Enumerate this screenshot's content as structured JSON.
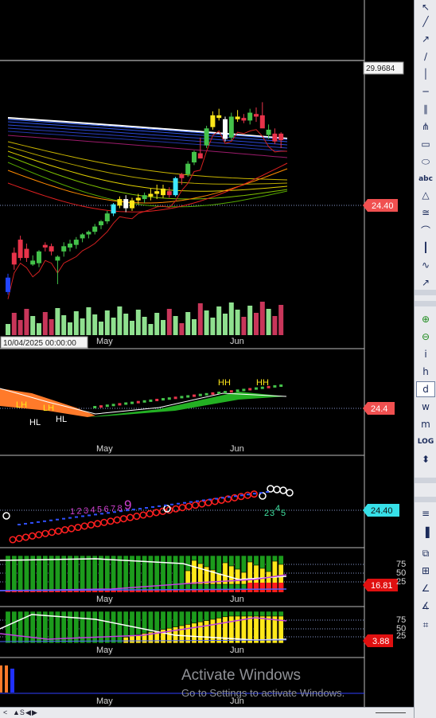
{
  "chart_data": {
    "type": "candlestick",
    "x_labels": [
      "May",
      "Jun"
    ],
    "cursor_date": "10/04/2025 00:00:00",
    "price_scale_top": "29.9684",
    "last_price": "24.40",
    "candles": [
      {
        "o": 12.8,
        "h": 14.2,
        "l": 12.6,
        "c": 13.9,
        "col": "blue"
      },
      {
        "o": 15.8,
        "h": 16.2,
        "l": 14.5,
        "c": 14.9,
        "col": "red"
      },
      {
        "o": 16.8,
        "h": 17.1,
        "l": 15.2,
        "c": 15.4,
        "col": "red"
      },
      {
        "o": 15.4,
        "h": 16.5,
        "l": 15.1,
        "c": 16.1,
        "col": "red"
      },
      {
        "o": 15.2,
        "h": 15.6,
        "l": 14.8,
        "c": 14.9,
        "col": "green"
      },
      {
        "o": 15.0,
        "h": 16.0,
        "l": 14.7,
        "c": 15.9,
        "col": "green"
      },
      {
        "o": 16.2,
        "h": 16.6,
        "l": 15.9,
        "c": 16.4,
        "col": "red"
      },
      {
        "o": 15.9,
        "h": 16.5,
        "l": 15.6,
        "c": 16.3,
        "col": "red"
      },
      {
        "o": 15.2,
        "h": 15.6,
        "l": 13.4,
        "c": 15.5,
        "col": "green"
      },
      {
        "o": 15.9,
        "h": 16.6,
        "l": 15.5,
        "c": 16.3,
        "col": "green"
      },
      {
        "o": 16.2,
        "h": 16.8,
        "l": 15.9,
        "c": 16.5,
        "col": "green"
      },
      {
        "o": 16.4,
        "h": 17.0,
        "l": 16.1,
        "c": 16.8,
        "col": "green"
      },
      {
        "o": 16.9,
        "h": 17.3,
        "l": 16.6,
        "c": 17.2,
        "col": "green"
      },
      {
        "o": 17.2,
        "h": 17.5,
        "l": 16.9,
        "c": 17.4,
        "col": "green"
      },
      {
        "o": 17.4,
        "h": 18.0,
        "l": 17.2,
        "c": 17.8,
        "col": "green"
      },
      {
        "o": 17.9,
        "h": 18.3,
        "l": 17.6,
        "c": 18.2,
        "col": "green"
      },
      {
        "o": 18.2,
        "h": 19.0,
        "l": 18.0,
        "c": 18.8,
        "col": "green"
      },
      {
        "o": 18.8,
        "h": 19.6,
        "l": 18.6,
        "c": 19.5,
        "col": "cyan"
      },
      {
        "o": 19.4,
        "h": 20.1,
        "l": 19.2,
        "c": 19.9,
        "col": "yellow"
      },
      {
        "o": 19.9,
        "h": 20.2,
        "l": 18.9,
        "c": 19.2,
        "col": "white"
      },
      {
        "o": 19.2,
        "h": 20.0,
        "l": 19.0,
        "c": 19.8,
        "col": "yellow"
      },
      {
        "o": 19.8,
        "h": 20.3,
        "l": 19.5,
        "c": 20.0,
        "col": "yellow"
      },
      {
        "o": 19.9,
        "h": 20.4,
        "l": 19.6,
        "c": 20.2,
        "col": "green"
      },
      {
        "o": 20.1,
        "h": 20.7,
        "l": 19.8,
        "c": 20.3,
        "col": "yellow"
      },
      {
        "o": 20.3,
        "h": 21.0,
        "l": 19.9,
        "c": 20.5,
        "col": "yellow"
      },
      {
        "o": 20.2,
        "h": 21.0,
        "l": 20.0,
        "c": 20.7,
        "col": "yellow"
      },
      {
        "o": 20.5,
        "h": 20.8,
        "l": 20.0,
        "c": 20.2,
        "col": "red"
      },
      {
        "o": 20.2,
        "h": 21.6,
        "l": 20.1,
        "c": 21.5,
        "col": "cyan"
      },
      {
        "o": 21.5,
        "h": 21.9,
        "l": 21.0,
        "c": 21.8,
        "col": "red"
      },
      {
        "o": 21.8,
        "h": 22.8,
        "l": 21.6,
        "c": 22.6,
        "col": "green"
      },
      {
        "o": 22.7,
        "h": 23.6,
        "l": 22.5,
        "c": 23.5,
        "col": "green"
      },
      {
        "o": 23.4,
        "h": 24.6,
        "l": 23.2,
        "c": 23.0,
        "col": "red"
      },
      {
        "o": 24.0,
        "h": 25.5,
        "l": 23.8,
        "c": 25.3,
        "col": "green"
      },
      {
        "o": 25.4,
        "h": 26.6,
        "l": 25.2,
        "c": 26.3,
        "col": "yellow"
      },
      {
        "o": 26.3,
        "h": 26.8,
        "l": 25.9,
        "c": 26.1,
        "col": "yellow"
      },
      {
        "o": 26.0,
        "h": 26.2,
        "l": 24.3,
        "c": 24.5,
        "col": "white"
      },
      {
        "o": 24.6,
        "h": 26.5,
        "l": 24.4,
        "c": 26.2,
        "col": "green"
      },
      {
        "o": 26.2,
        "h": 26.7,
        "l": 25.8,
        "c": 26.0,
        "col": "yellow"
      },
      {
        "o": 26.1,
        "h": 26.4,
        "l": 25.7,
        "c": 25.9,
        "col": "red"
      },
      {
        "o": 25.9,
        "h": 26.8,
        "l": 25.6,
        "c": 26.5,
        "col": "green"
      },
      {
        "o": 26.4,
        "h": 26.9,
        "l": 25.8,
        "c": 26.2,
        "col": "red"
      },
      {
        "o": 26.3,
        "h": 27.3,
        "l": 25.5,
        "c": 25.3,
        "col": "red"
      },
      {
        "o": 25.2,
        "h": 25.6,
        "l": 24.5,
        "c": 24.8,
        "col": "green"
      },
      {
        "o": 24.3,
        "h": 25.3,
        "l": 24.1,
        "c": 24.9,
        "col": "red"
      },
      {
        "o": 24.9,
        "h": 25.0,
        "l": 23.8,
        "c": 24.4,
        "col": "red"
      }
    ],
    "swing_labels_upper": [
      "HH",
      "HH"
    ],
    "swing_labels_lower": [
      "LH",
      "LH",
      "HL",
      "HL"
    ],
    "panel2_value": "24.4",
    "count_labels_magenta": [
      "1",
      "2",
      "3",
      "4",
      "5",
      "6",
      "7",
      "8",
      "9"
    ],
    "count_labels_cyan": [
      "2",
      "3",
      "4",
      "5"
    ],
    "panel3_value": "24.40",
    "osc1_levels": [
      "75",
      "50",
      "25"
    ],
    "osc1_value": "16.81",
    "osc2_levels": [
      "75",
      "50",
      "25"
    ],
    "osc2_value": "3.88"
  },
  "watermark": {
    "title": "Activate Windows",
    "subtitle": "Go to Settings to activate Windows."
  },
  "toolbar": {
    "tools": [
      "cursor-icon",
      "line-segment-icon",
      "ray-icon",
      "extended-line-icon",
      "vertical-line-icon",
      "horizontal-line-icon",
      "parallel-lines-icon",
      "pitchfork-icon",
      "rectangle-icon",
      "ellipse-icon",
      "text-icon",
      "triangle-icon",
      "fib-fan-icon",
      "arc-icon",
      "cycle-lines-icon",
      "wave-icon",
      "arrow-icon",
      "zoom-in-icon",
      "zoom-out-icon",
      "italic-i-icon",
      "h-icon",
      "d-icon",
      "w-icon",
      "m-icon",
      "log-icon",
      "updown-icon",
      "grid-lines-icon",
      "volume-bars-icon",
      "layers-icon",
      "table-icon",
      "angle-icon",
      "trend-angle-icon",
      "grid-icon"
    ],
    "text_glyphs": {
      "abc": "abc",
      "log": "LOG",
      "d": "d",
      "w": "w",
      "m": "m",
      "h": "h",
      "i": "i"
    }
  },
  "bottom_bar": {
    "items": [
      "<",
      "▲S",
      "◀",
      "▶"
    ]
  }
}
